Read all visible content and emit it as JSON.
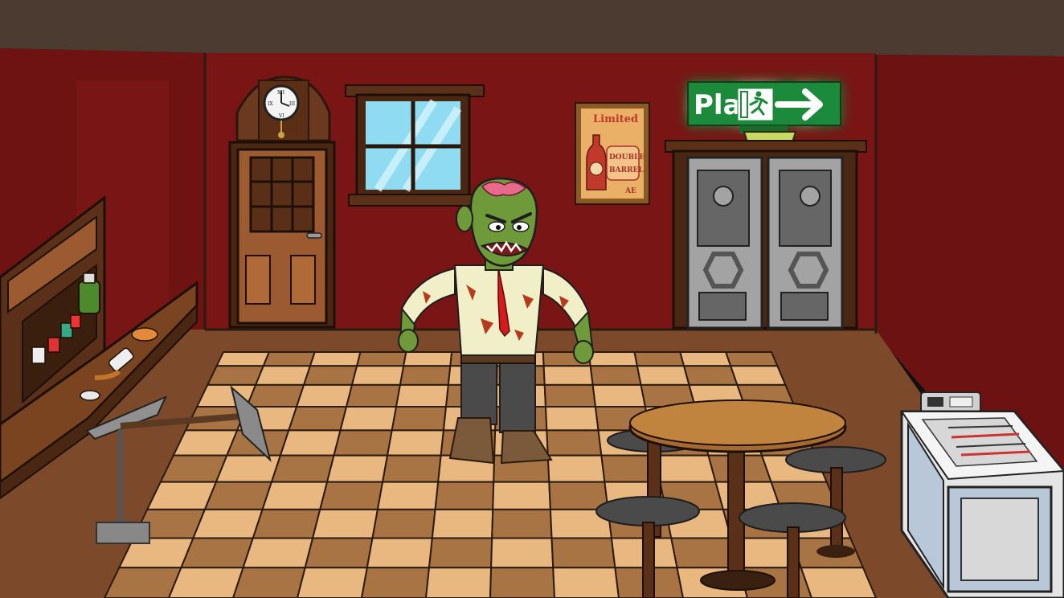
{
  "game": {
    "play_label": "Play",
    "poster": {
      "line1": "Limited",
      "line2": "DOUBLE",
      "line3": "BARREL",
      "mark": "AE"
    },
    "clock_numerals": [
      "XII",
      "III",
      "VI",
      "IX"
    ]
  },
  "colors": {
    "wall": "#7a1414",
    "ceiling": "#4a3a30",
    "floor_wood": "#7a4a2a",
    "sign_green": "#1f8a3a",
    "zombie_skin": "#6f9a3a"
  },
  "icons": {
    "exit": "running-man-icon",
    "arrow": "arrow-right-icon"
  }
}
